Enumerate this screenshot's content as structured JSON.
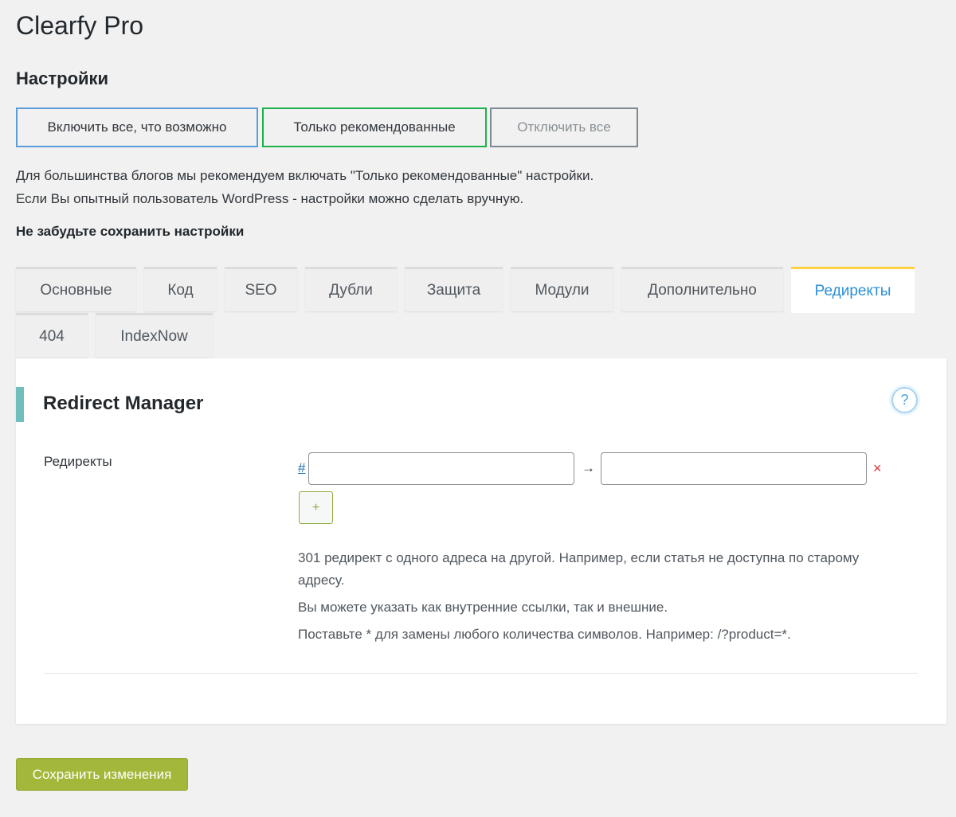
{
  "app": {
    "title": "Clearfy Pro"
  },
  "settings": {
    "title": "Настройки",
    "presets": {
      "enable_all": "Включить все, что возможно",
      "recommended": "Только рекомендованные",
      "disable_all": "Отключить все"
    },
    "intro": [
      "Для большинства блогов мы рекомендуем включать \"Только рекомендованные\" настройки.",
      "Если Вы опытный пользователь WordPress - настройки можно сделать вручную."
    ],
    "reminder": "Не забудьте сохранить настройки"
  },
  "tabs": [
    {
      "label": "Основные",
      "active": false
    },
    {
      "label": "Код",
      "active": false
    },
    {
      "label": "SEO",
      "active": false
    },
    {
      "label": "Дубли",
      "active": false
    },
    {
      "label": "Защита",
      "active": false
    },
    {
      "label": "Модули",
      "active": false
    },
    {
      "label": "Дополнительно",
      "active": false
    },
    {
      "label": "Редиректы",
      "active": true
    },
    {
      "label": "404",
      "active": false
    },
    {
      "label": "IndexNow",
      "active": false
    }
  ],
  "panel": {
    "title": "Redirect Manager",
    "help_icon": "?",
    "field_label": "Редиректы",
    "hash_link": "#",
    "arrow": "→",
    "from_value": "",
    "to_value": "",
    "remove_icon": "×",
    "add_label": "+",
    "help": [
      "301 редирект с одного адреса на другой. Например, если статья не доступна по старому адресу.",
      "Вы можете указать как внутренние ссылки, так и внешние.",
      "Поставьте * для замены любого количества символов. Например: /?product=*."
    ]
  },
  "footer": {
    "save_label": "Сохранить изменения"
  },
  "colors": {
    "accent_blue": "#2c8fd6",
    "active_tab_border": "#ffd040",
    "save_button": "#a3b83a",
    "panel_accent": "#71bfbc",
    "remove_red": "#d63638"
  }
}
